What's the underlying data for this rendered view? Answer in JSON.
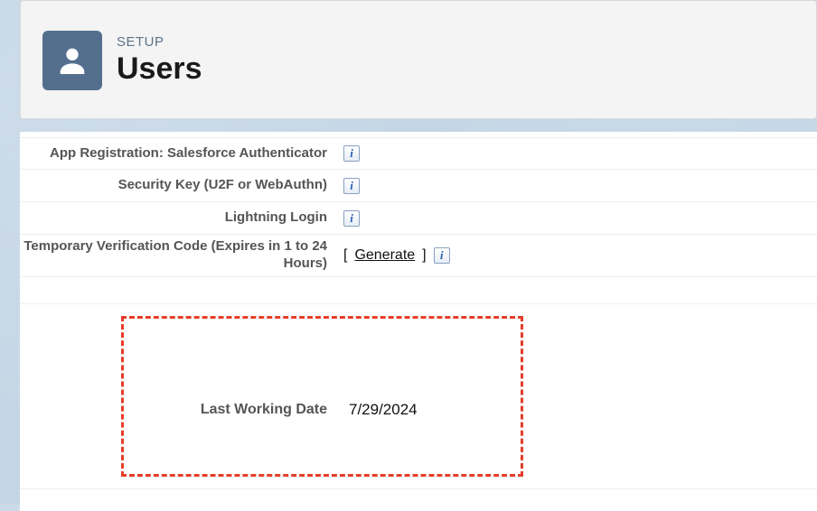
{
  "header": {
    "setup_label": "SETUP",
    "title": "Users"
  },
  "fields": {
    "app_reg": {
      "label": "App Registration: Salesforce Authenticator"
    },
    "security_key": {
      "label": "Security Key (U2F or WebAuthn)"
    },
    "lightning_login": {
      "label": "Lightning Login"
    },
    "temp_code": {
      "label": "Temporary Verification Code (Expires in 1 to 24 Hours)",
      "generate": "Generate"
    }
  },
  "last_working_date": {
    "label": "Last Working Date",
    "value": "7/29/2024"
  }
}
